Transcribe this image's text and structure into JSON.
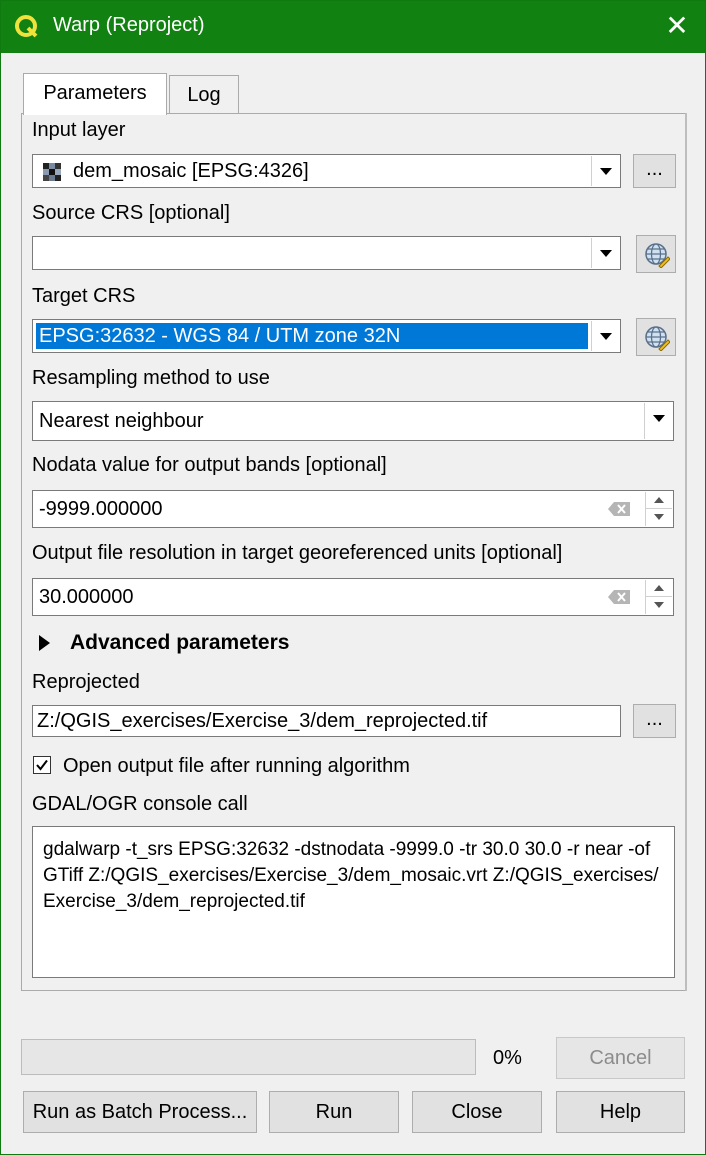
{
  "window": {
    "title": "Warp (Reproject)",
    "close_glyph": "✕",
    "accent_color": "#118211"
  },
  "tabs": [
    {
      "label": "Parameters",
      "active": true
    },
    {
      "label": "Log",
      "active": false
    }
  ],
  "params": {
    "input_layer": {
      "label": "Input layer",
      "value": "dem_mosaic [EPSG:4326]",
      "browse_label": "..."
    },
    "source_crs": {
      "label": "Source CRS [optional]",
      "value": ""
    },
    "target_crs": {
      "label": "Target CRS",
      "value": "EPSG:32632 - WGS 84 / UTM zone 32N"
    },
    "resampling": {
      "label": "Resampling method to use",
      "value": "Nearest neighbour"
    },
    "nodata": {
      "label": "Nodata value for output bands [optional]",
      "value": "-9999.000000"
    },
    "resolution": {
      "label": "Output file resolution in target georeferenced units [optional]",
      "value": "30.000000"
    },
    "advanced": {
      "label": "Advanced parameters"
    },
    "reprojected": {
      "label": "Reprojected",
      "value": "Z:/QGIS_exercises/Exercise_3/dem_reprojected.tif",
      "browse_label": "..."
    },
    "open_output": {
      "label": "Open output file after running algorithm",
      "checked": true
    },
    "console": {
      "label": "GDAL/OGR console call",
      "value": "gdalwarp -t_srs EPSG:32632 -dstnodata -9999.0 -tr 30.0 30.0 -r near -of GTiff Z:/QGIS_exercises/Exercise_3/dem_mosaic.vrt Z:/QGIS_exercises/Exercise_3/dem_reprojected.tif"
    }
  },
  "progress": {
    "value": 0,
    "label": "0%"
  },
  "buttons": {
    "cancel": "Cancel",
    "batch": "Run as Batch Process...",
    "run": "Run",
    "close": "Close",
    "help": "Help"
  },
  "icons": {
    "app": "qgis-logo-icon",
    "raster": "raster-layer-icon",
    "crs": "crs-globe-icon",
    "clear": "clear-field-icon"
  }
}
